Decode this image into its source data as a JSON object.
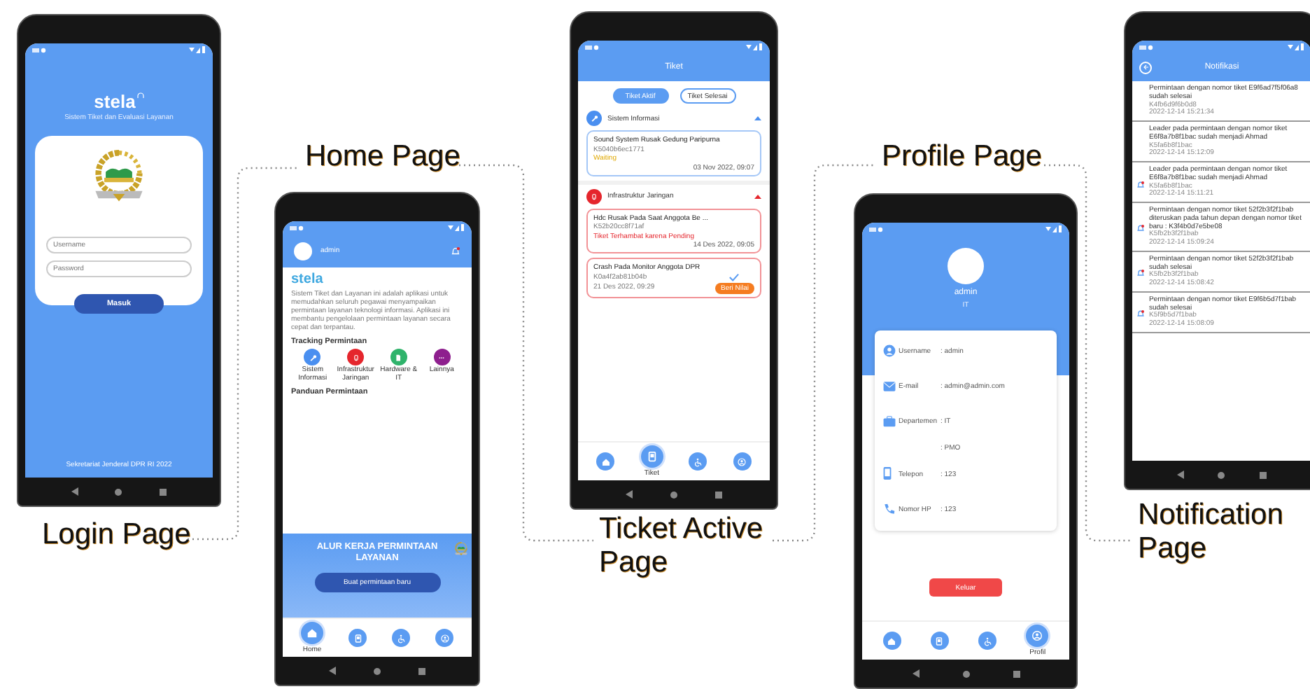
{
  "screens": [
    {
      "kind": "login",
      "caption": "Login Page",
      "app_name": "stela",
      "tagline": "Sistem Tiket dan Evaluasi Layanan",
      "fields": [
        {
          "placeholder": "Username"
        },
        {
          "placeholder": "Password"
        }
      ],
      "button": "Masuk",
      "footer": "Sekretariat Jenderal DPR RI 2022"
    },
    {
      "kind": "home",
      "caption": "Home Page",
      "user": "admin",
      "app_name": "stela",
      "description": "Sistem Tiket dan Layanan ini adalah aplikasi untuk memudahkan seluruh pegawai menyampaikan permintaan layanan teknologi informasi. Aplikasi ini membantu pengelolaan permintaan layanan secara cepat dan terpantau.",
      "tracking_title": "Tracking Permintaan",
      "tracking": [
        {
          "label": "Sistem Informasi",
          "color": "#4a8ff0"
        },
        {
          "label": "Infrastruktur Jaringan",
          "color": "#e5262d"
        },
        {
          "label": "Hardware & IT",
          "color": "#2fb36b"
        },
        {
          "label": "Lainnya",
          "color": "#8e1f8e"
        }
      ],
      "guide_title": "Panduan Permintaan",
      "banner_title": "ALUR KERJA PERMINTAAN LAYANAN",
      "banner_button": "Buat permintaan baru",
      "nav": [
        {
          "label": "Home",
          "selected": true
        },
        {
          "selected": false
        },
        {
          "selected": false
        },
        {
          "selected": false
        }
      ]
    },
    {
      "kind": "tickets",
      "caption": "Ticket Active Page",
      "title": "Tiket",
      "tabs": [
        {
          "label": "Tiket Aktif",
          "selected": true
        },
        {
          "label": "Tiket Selesai",
          "selected": false
        }
      ],
      "sections": [
        {
          "title": "Sistem Informasi",
          "color": "#4a8ff0",
          "expanded": true,
          "tickets": [
            {
              "title": "Sound System Rusak Gedung Paripurna",
              "code": "K5040b6ec1771",
              "status": "Waiting",
              "kind": "waiting",
              "date": "03 Nov 2022, 09:07"
            }
          ]
        },
        {
          "title": "Infrastruktur Jaringan",
          "color": "#e5262d",
          "expanded": true,
          "tickets": [
            {
              "title": "Hdc Rusak Pada Saat Anggota Be ...",
              "code": "K52b20cc8f71af",
              "status": "Tiket Terhambat karena Pending",
              "kind": "blocked",
              "date": "14 Des 2022, 09:05"
            },
            {
              "title": "Crash Pada Monitor Anggota DPR",
              "code": "K0a4f2ab81b04b",
              "date": "21 Des 2022, 09:29",
              "done": true,
              "action": "Beri Nilai"
            }
          ]
        }
      ],
      "nav": [
        {
          "selected": false
        },
        {
          "label": "Tiket",
          "selected": true
        },
        {
          "selected": false
        },
        {
          "selected": false
        }
      ]
    },
    {
      "kind": "profile",
      "caption": "Profile Page",
      "name": "admin",
      "role": "IT",
      "rows": [
        {
          "label": "Username",
          "value": ": admin"
        },
        {
          "label": "E-mail",
          "value": ": admin@admin.com"
        },
        {
          "label": "Departemen",
          "value": ": IT"
        },
        {
          "value": ": PMO"
        },
        {
          "label": "Telepon",
          "value": ": 123"
        },
        {
          "label": "Nomor HP",
          "value": ": 123"
        }
      ],
      "button": "Keluar",
      "nav": [
        {
          "selected": false
        },
        {
          "selected": false
        },
        {
          "selected": false
        },
        {
          "label": "Profil",
          "selected": true
        }
      ]
    },
    {
      "kind": "notifications",
      "caption": "Notification Page",
      "title": "Notifikasi",
      "items": [
        {
          "message": "Permintaan dengan nomor tiket E9f6ad7f5f06a8 sudah selesai",
          "code": "K4fb6d9f6b0d8",
          "time": "2022-12-14 15:21:34",
          "unread": false
        },
        {
          "message": "Leader pada permintaan dengan nomor tiket E6f8a7b8f1bac sudah menjadi Ahmad",
          "code": "K5fa6b8f1bac",
          "time": "2022-12-14 15:12:09",
          "unread": false
        },
        {
          "message": "Leader pada permintaan dengan nomor tiket E6f8a7b8f1bac sudah menjadi Ahmad",
          "code": "K5fa6b8f1bac",
          "time": "2022-12-14 15:11:21",
          "unread": true
        },
        {
          "message": "Permintaan dengan nomor tiket 52f2b3f2f1bab diteruskan pada tahun depan dengan nomor tiket baru : K3f4b0d7e5be08",
          "code": "K5fb2b3f2f1bab",
          "time": "2022-12-14 15:09:24",
          "unread": true
        },
        {
          "message": "Permintaan dengan nomor tiket 52f2b3f2f1bab sudah selesai",
          "code": "K5fb2b3f2f1bab",
          "time": "2022-12-14 15:08:42",
          "unread": true
        },
        {
          "message": "Permintaan dengan nomor tiket E9f6b5d7f1bab sudah selesai",
          "code": "K5f9b5d7f1bab",
          "time": "2022-12-14 15:08:09",
          "unread": true
        }
      ]
    }
  ]
}
